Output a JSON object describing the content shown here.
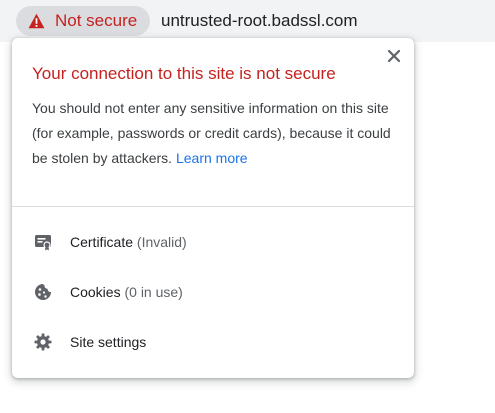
{
  "omnibox": {
    "security_chip": {
      "icon": "warning-triangle-icon",
      "label": "Not secure",
      "color": "#c5221f"
    },
    "url": "untrusted-root.badssl.com"
  },
  "popup": {
    "title": "Your connection to this site is not secure",
    "description": "You should not enter any sensitive information on this site (for example, passwords or credit cards), because it could be stolen by attackers.",
    "learn_more": "Learn more",
    "close_icon": "close-icon",
    "items": [
      {
        "icon": "certificate-icon",
        "label": "Certificate",
        "status": "(Invalid)"
      },
      {
        "icon": "cookie-icon",
        "label": "Cookies",
        "status": "(0 in use)"
      },
      {
        "icon": "gear-icon",
        "label": "Site settings"
      }
    ]
  },
  "colors": {
    "warning": "#c5221f",
    "link": "#1a73e8",
    "text": "#202124",
    "secondary": "#5f6368"
  }
}
